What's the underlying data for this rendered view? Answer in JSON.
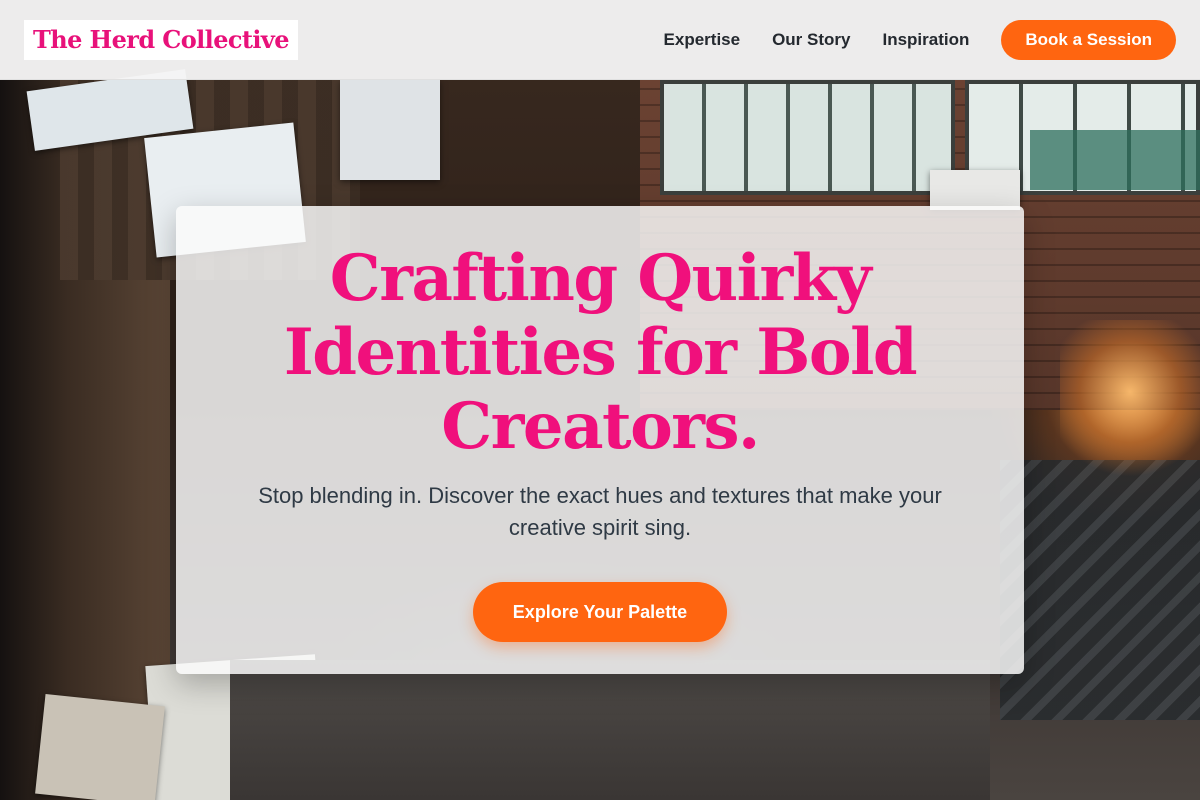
{
  "header": {
    "logo_text": "The Herd Collective",
    "nav": [
      {
        "label": "Expertise"
      },
      {
        "label": "Our Story"
      },
      {
        "label": "Inspiration"
      }
    ],
    "cta_label": "Book a Session"
  },
  "hero": {
    "title": "Crafting Quirky Identities for Bold Creators.",
    "subtitle": "Stop blending in. Discover the exact hues and textures that make your creative spirit sing.",
    "cta_label": "Explore Your Palette",
    "background": "art-studio-photo"
  },
  "colors": {
    "accent_pink": "#f0107c",
    "accent_orange": "#ff6510",
    "text_dark": "#24292f"
  }
}
